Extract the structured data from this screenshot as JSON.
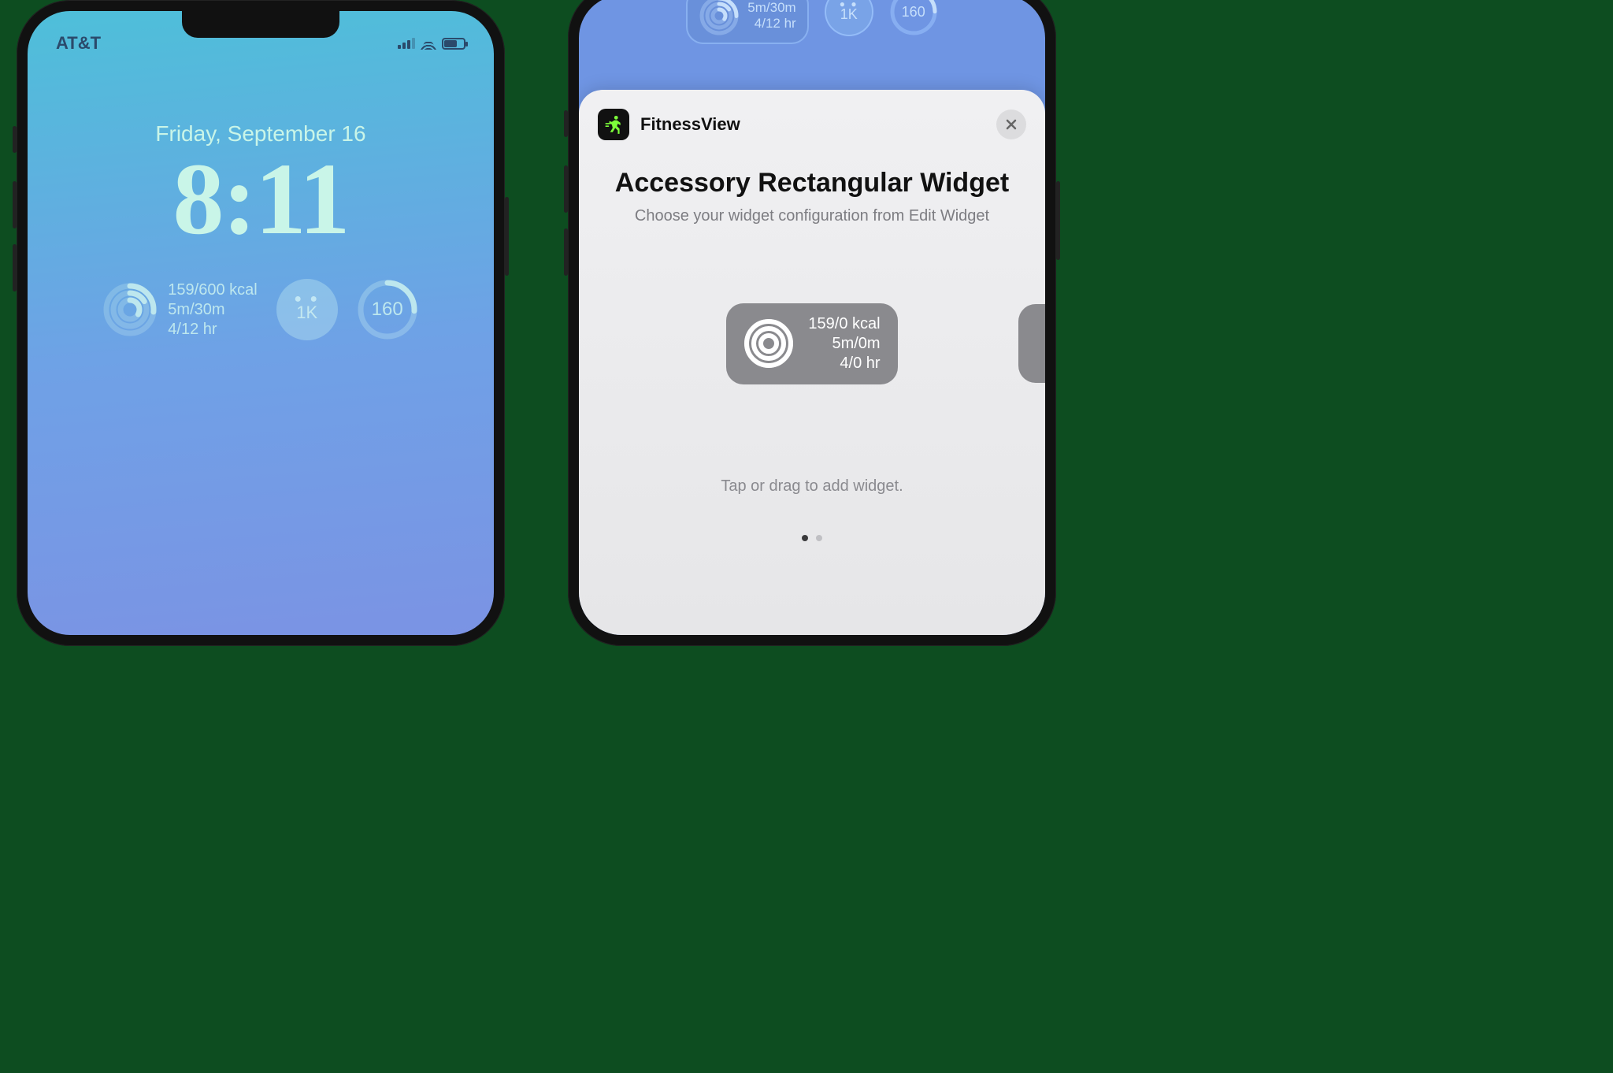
{
  "left": {
    "carrier": "AT&T",
    "date": "Friday, September 16",
    "time": "8:11",
    "widget_rect": {
      "line1": "159/600 kcal",
      "line2": "5m/30m",
      "line3": "4/12 hr"
    },
    "steps_widget": {
      "icon": "👣",
      "label": "1K"
    },
    "hr_widget": {
      "label": "160"
    }
  },
  "right": {
    "top_rect": {
      "line1": "5m/30m",
      "line2": "4/12 hr"
    },
    "top_steps": "1K",
    "top_hr": "160",
    "sheet": {
      "app_name": "FitnessView",
      "title": "Accessory Rectangular Widget",
      "subtitle": "Choose your widget configuration from Edit Widget",
      "preview": {
        "line1": "159/0 kcal",
        "line2": "5m/0m",
        "line3": "4/0 hr"
      },
      "hint": "Tap or drag to add widget."
    }
  }
}
